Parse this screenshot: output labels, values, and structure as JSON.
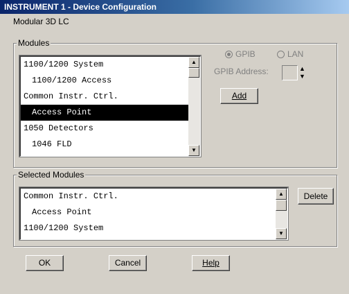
{
  "window": {
    "title": "INSTRUMENT 1 - Device Configuration",
    "subtitle": "Modular 3D LC"
  },
  "modules": {
    "legend": "Modules",
    "items": [
      {
        "label": "1100/1200 System",
        "indent": false,
        "selected": false
      },
      {
        "label": "1100/1200 Access",
        "indent": true,
        "selected": false
      },
      {
        "label": "Common Instr. Ctrl.",
        "indent": false,
        "selected": false
      },
      {
        "label": "Access Point",
        "indent": true,
        "selected": true
      },
      {
        "label": "1050 Detectors",
        "indent": false,
        "selected": false
      },
      {
        "label": "1046 FLD",
        "indent": true,
        "selected": false
      }
    ],
    "radio_gpib": "GPIB",
    "radio_lan": "LAN",
    "gpib_address_label": "GPIB Address:",
    "add_button": "Add"
  },
  "selected_modules": {
    "legend": "Selected Modules",
    "items": [
      {
        "label": "Common Instr. Ctrl.",
        "indent": false
      },
      {
        "label": "Access Point",
        "indent": true
      },
      {
        "label": "1100/1200 System",
        "indent": false
      }
    ],
    "delete_button": "Delete"
  },
  "buttons": {
    "ok": "OK",
    "cancel": "Cancel",
    "help": "Help"
  },
  "icons": {
    "scroll_up": "scroll-up-arrow-icon",
    "scroll_down": "scroll-down-arrow-icon",
    "spin": "spin-up-down-icon"
  }
}
